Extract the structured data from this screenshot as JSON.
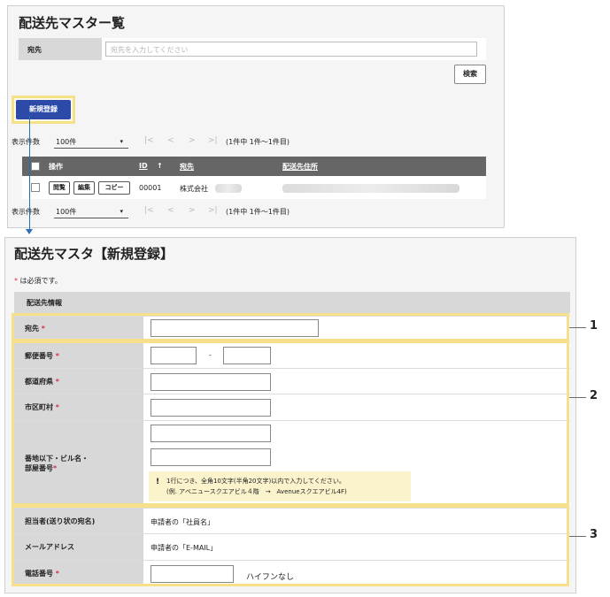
{
  "list": {
    "title": "配送先マスター覧",
    "search_label": "宛先",
    "search_placeholder": "宛先を入力してください",
    "search_button": "検索",
    "new_button": "新規登録",
    "pager_label": "表示件数",
    "pager_value": "100件",
    "pager_count": "(1件中 1件～1件目)",
    "nav_first": "|<",
    "nav_prev": "<",
    "nav_next": ">",
    "nav_last": ">|",
    "columns": {
      "action": "操作",
      "id": "ID",
      "id_sort": "↑",
      "dest": "宛先",
      "address": "配送先住所"
    },
    "row": {
      "view": "閲覧",
      "edit": "編集",
      "copy": "コピー",
      "id": "00001",
      "dest": "株式会社"
    }
  },
  "form": {
    "title": "配送先マスタ【新規登録】",
    "required_star": "*",
    "required_note": "は必須です。",
    "section": "配送先情報",
    "fields": {
      "dest": "宛先",
      "zip": "郵便番号",
      "zip_sep": "-",
      "pref": "都道府県",
      "city": "市区町村",
      "street_1": "番地以下・ビル名・",
      "street_2": "部屋番号",
      "contact": "担当者(送り状の宛名)",
      "contact_value": "申請者の「社員名」",
      "email": "メールアドレス",
      "email_value": "申請者の「E-MAIL」",
      "phone": "電話番号",
      "phone_suffix": "ハイフンなし"
    },
    "hint": {
      "icon": "!",
      "line1": "1行につき、全角10文字(半角20文字)以内で入力してください。",
      "line2": "(例. アベニュースクエアビル４階　→　Avenueスクエアビル4F)"
    }
  },
  "callouts": [
    "1",
    "2",
    "3"
  ],
  "colors": {
    "primary_button": "#2c4aa8",
    "highlight": "#f6e08a",
    "required": "#d0344a",
    "connector": "#2a6fb5"
  }
}
